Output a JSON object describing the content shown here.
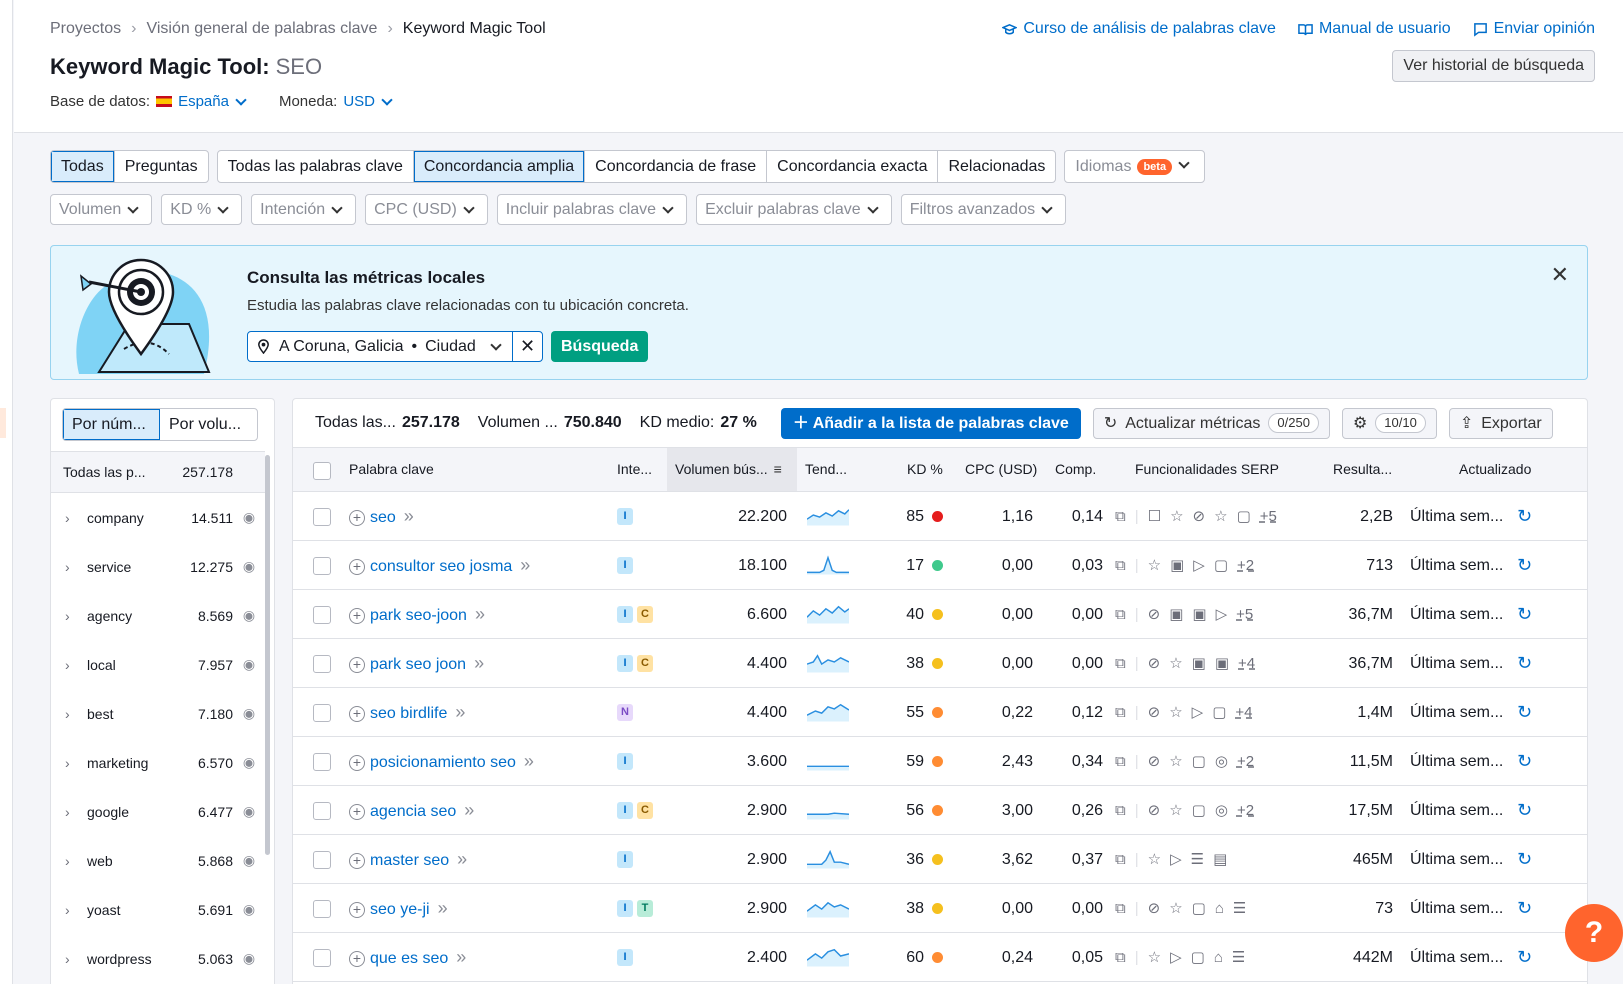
{
  "breadcrumbs": [
    "Proyectos",
    "Visión general de palabras clave",
    "Keyword Magic Tool"
  ],
  "top_links": [
    {
      "label": "Curso de análisis de palabras clave",
      "icon": "graduation-cap-icon"
    },
    {
      "label": "Manual de usuario",
      "icon": "book-icon"
    },
    {
      "label": "Enviar opinión",
      "icon": "chat-icon"
    }
  ],
  "title": {
    "tool": "Keyword Magic Tool:",
    "query": "SEO"
  },
  "history_button": "Ver historial de búsqueda",
  "database": {
    "label": "Base de datos:",
    "value": "España",
    "flag_colors": [
      "#c60b1e",
      "#ffc400"
    ]
  },
  "currency": {
    "label": "Moneda:",
    "value": "USD"
  },
  "tabs_group1": [
    {
      "label": "Todas",
      "active": true
    },
    {
      "label": "Preguntas",
      "active": false
    }
  ],
  "tabs_group2": [
    {
      "label": "Todas las palabras clave",
      "active": false
    },
    {
      "label": "Concordancia amplia",
      "active": true
    },
    {
      "label": "Concordancia de frase",
      "active": false
    },
    {
      "label": "Concordancia exacta",
      "active": false
    },
    {
      "label": "Relacionadas",
      "active": false
    }
  ],
  "languages": {
    "label": "Idiomas",
    "badge": "beta"
  },
  "filters": [
    "Volumen",
    "KD %",
    "Intención",
    "CPC (USD)",
    "Incluir palabras clave",
    "Excluir palabras clave",
    "Filtros avanzados"
  ],
  "banner": {
    "title": "Consulta las métricas locales",
    "description": "Estudia las palabras clave relacionadas con tu ubicación concreta.",
    "location": "A Coruna, Galicia",
    "location_type": "Ciudad",
    "search_button": "Búsqueda"
  },
  "left_panel": {
    "toggle": [
      "Por núm...",
      "Por volu..."
    ],
    "header": {
      "label": "Todas las p...",
      "count": "257.178"
    },
    "groups": [
      {
        "name": "company",
        "count": "14.511"
      },
      {
        "name": "service",
        "count": "12.275"
      },
      {
        "name": "agency",
        "count": "8.569"
      },
      {
        "name": "local",
        "count": "7.957"
      },
      {
        "name": "best",
        "count": "7.180"
      },
      {
        "name": "marketing",
        "count": "6.570"
      },
      {
        "name": "google",
        "count": "6.477"
      },
      {
        "name": "web",
        "count": "5.868"
      },
      {
        "name": "yoast",
        "count": "5.691"
      },
      {
        "name": "wordpress",
        "count": "5.063"
      }
    ]
  },
  "summary": {
    "all_label": "Todas las...",
    "all_value": "257.178",
    "volume_label": "Volumen ...",
    "volume_value": "750.840",
    "kd_label": "KD medio:",
    "kd_value": "27 %"
  },
  "toolbar": {
    "add_button": "Añadir a la lista de palabras clave",
    "update_button": "Actualizar métricas",
    "update_count": "0/250",
    "settings_count": "10/10",
    "export_button": "Exportar"
  },
  "columns": [
    "Palabra clave",
    "Inte...",
    "Volumen bús...",
    "Tend...",
    "KD %",
    "CPC (USD)",
    "Comp.",
    "Funcionalidades SERP",
    "Resulta...",
    "Actualizado"
  ],
  "kd_colors": {
    "red": "#e51d1d",
    "green": "#3fc98c",
    "yellow": "#f5c01e",
    "orange": "#ff8c33"
  },
  "rows": [
    {
      "keyword": "seo",
      "intent": [
        "I"
      ],
      "volume": "22.200",
      "kd": "85",
      "kd_color": "#e51d1d",
      "cpc": "1,16",
      "comp": "0,14",
      "serp_more": "+5",
      "results": "2,2B",
      "updated": "Última sem..."
    },
    {
      "keyword": "consultor seo josma",
      "intent": [
        "I"
      ],
      "volume": "18.100",
      "kd": "17",
      "kd_color": "#3fc98c",
      "cpc": "0,00",
      "comp": "0,03",
      "serp_more": "+2",
      "results": "713",
      "updated": "Última sem..."
    },
    {
      "keyword": "park seo-joon",
      "intent": [
        "I",
        "C"
      ],
      "volume": "6.600",
      "kd": "40",
      "kd_color": "#f5c01e",
      "cpc": "0,00",
      "comp": "0,00",
      "serp_more": "+5",
      "results": "36,7M",
      "updated": "Última sem..."
    },
    {
      "keyword": "park seo joon",
      "intent": [
        "I",
        "C"
      ],
      "volume": "4.400",
      "kd": "38",
      "kd_color": "#f5c01e",
      "cpc": "0,00",
      "comp": "0,00",
      "serp_more": "+4",
      "results": "36,7M",
      "updated": "Última sem..."
    },
    {
      "keyword": "seo birdlife",
      "intent": [
        "N"
      ],
      "volume": "4.400",
      "kd": "55",
      "kd_color": "#ff8c33",
      "cpc": "0,22",
      "comp": "0,12",
      "serp_more": "+4",
      "results": "1,4M",
      "updated": "Última sem..."
    },
    {
      "keyword": "posicionamiento seo",
      "intent": [
        "I"
      ],
      "volume": "3.600",
      "kd": "59",
      "kd_color": "#ff8c33",
      "cpc": "2,43",
      "comp": "0,34",
      "serp_more": "+2",
      "results": "11,5M",
      "updated": "Última sem..."
    },
    {
      "keyword": "agencia seo",
      "intent": [
        "I",
        "C"
      ],
      "volume": "2.900",
      "kd": "56",
      "kd_color": "#ff8c33",
      "cpc": "3,00",
      "comp": "0,26",
      "serp_more": "+2",
      "results": "17,5M",
      "updated": "Última sem..."
    },
    {
      "keyword": "master seo",
      "intent": [
        "I"
      ],
      "volume": "2.900",
      "kd": "36",
      "kd_color": "#f5c01e",
      "cpc": "3,62",
      "comp": "0,37",
      "serp_more": "",
      "results": "465M",
      "updated": "Última sem..."
    },
    {
      "keyword": "seo ye-ji",
      "intent": [
        "I",
        "T"
      ],
      "volume": "2.900",
      "kd": "38",
      "kd_color": "#f5c01e",
      "cpc": "0,00",
      "comp": "0,00",
      "serp_more": "",
      "results": "73",
      "updated": "Última sem..."
    },
    {
      "keyword": "que es seo",
      "intent": [
        "I"
      ],
      "volume": "2.400",
      "kd": "60",
      "kd_color": "#ff8c33",
      "cpc": "0,24",
      "comp": "0,05",
      "serp_more": "",
      "results": "442M",
      "updated": "Última sem..."
    }
  ],
  "help_button": "?",
  "accent_color": "#006dca"
}
